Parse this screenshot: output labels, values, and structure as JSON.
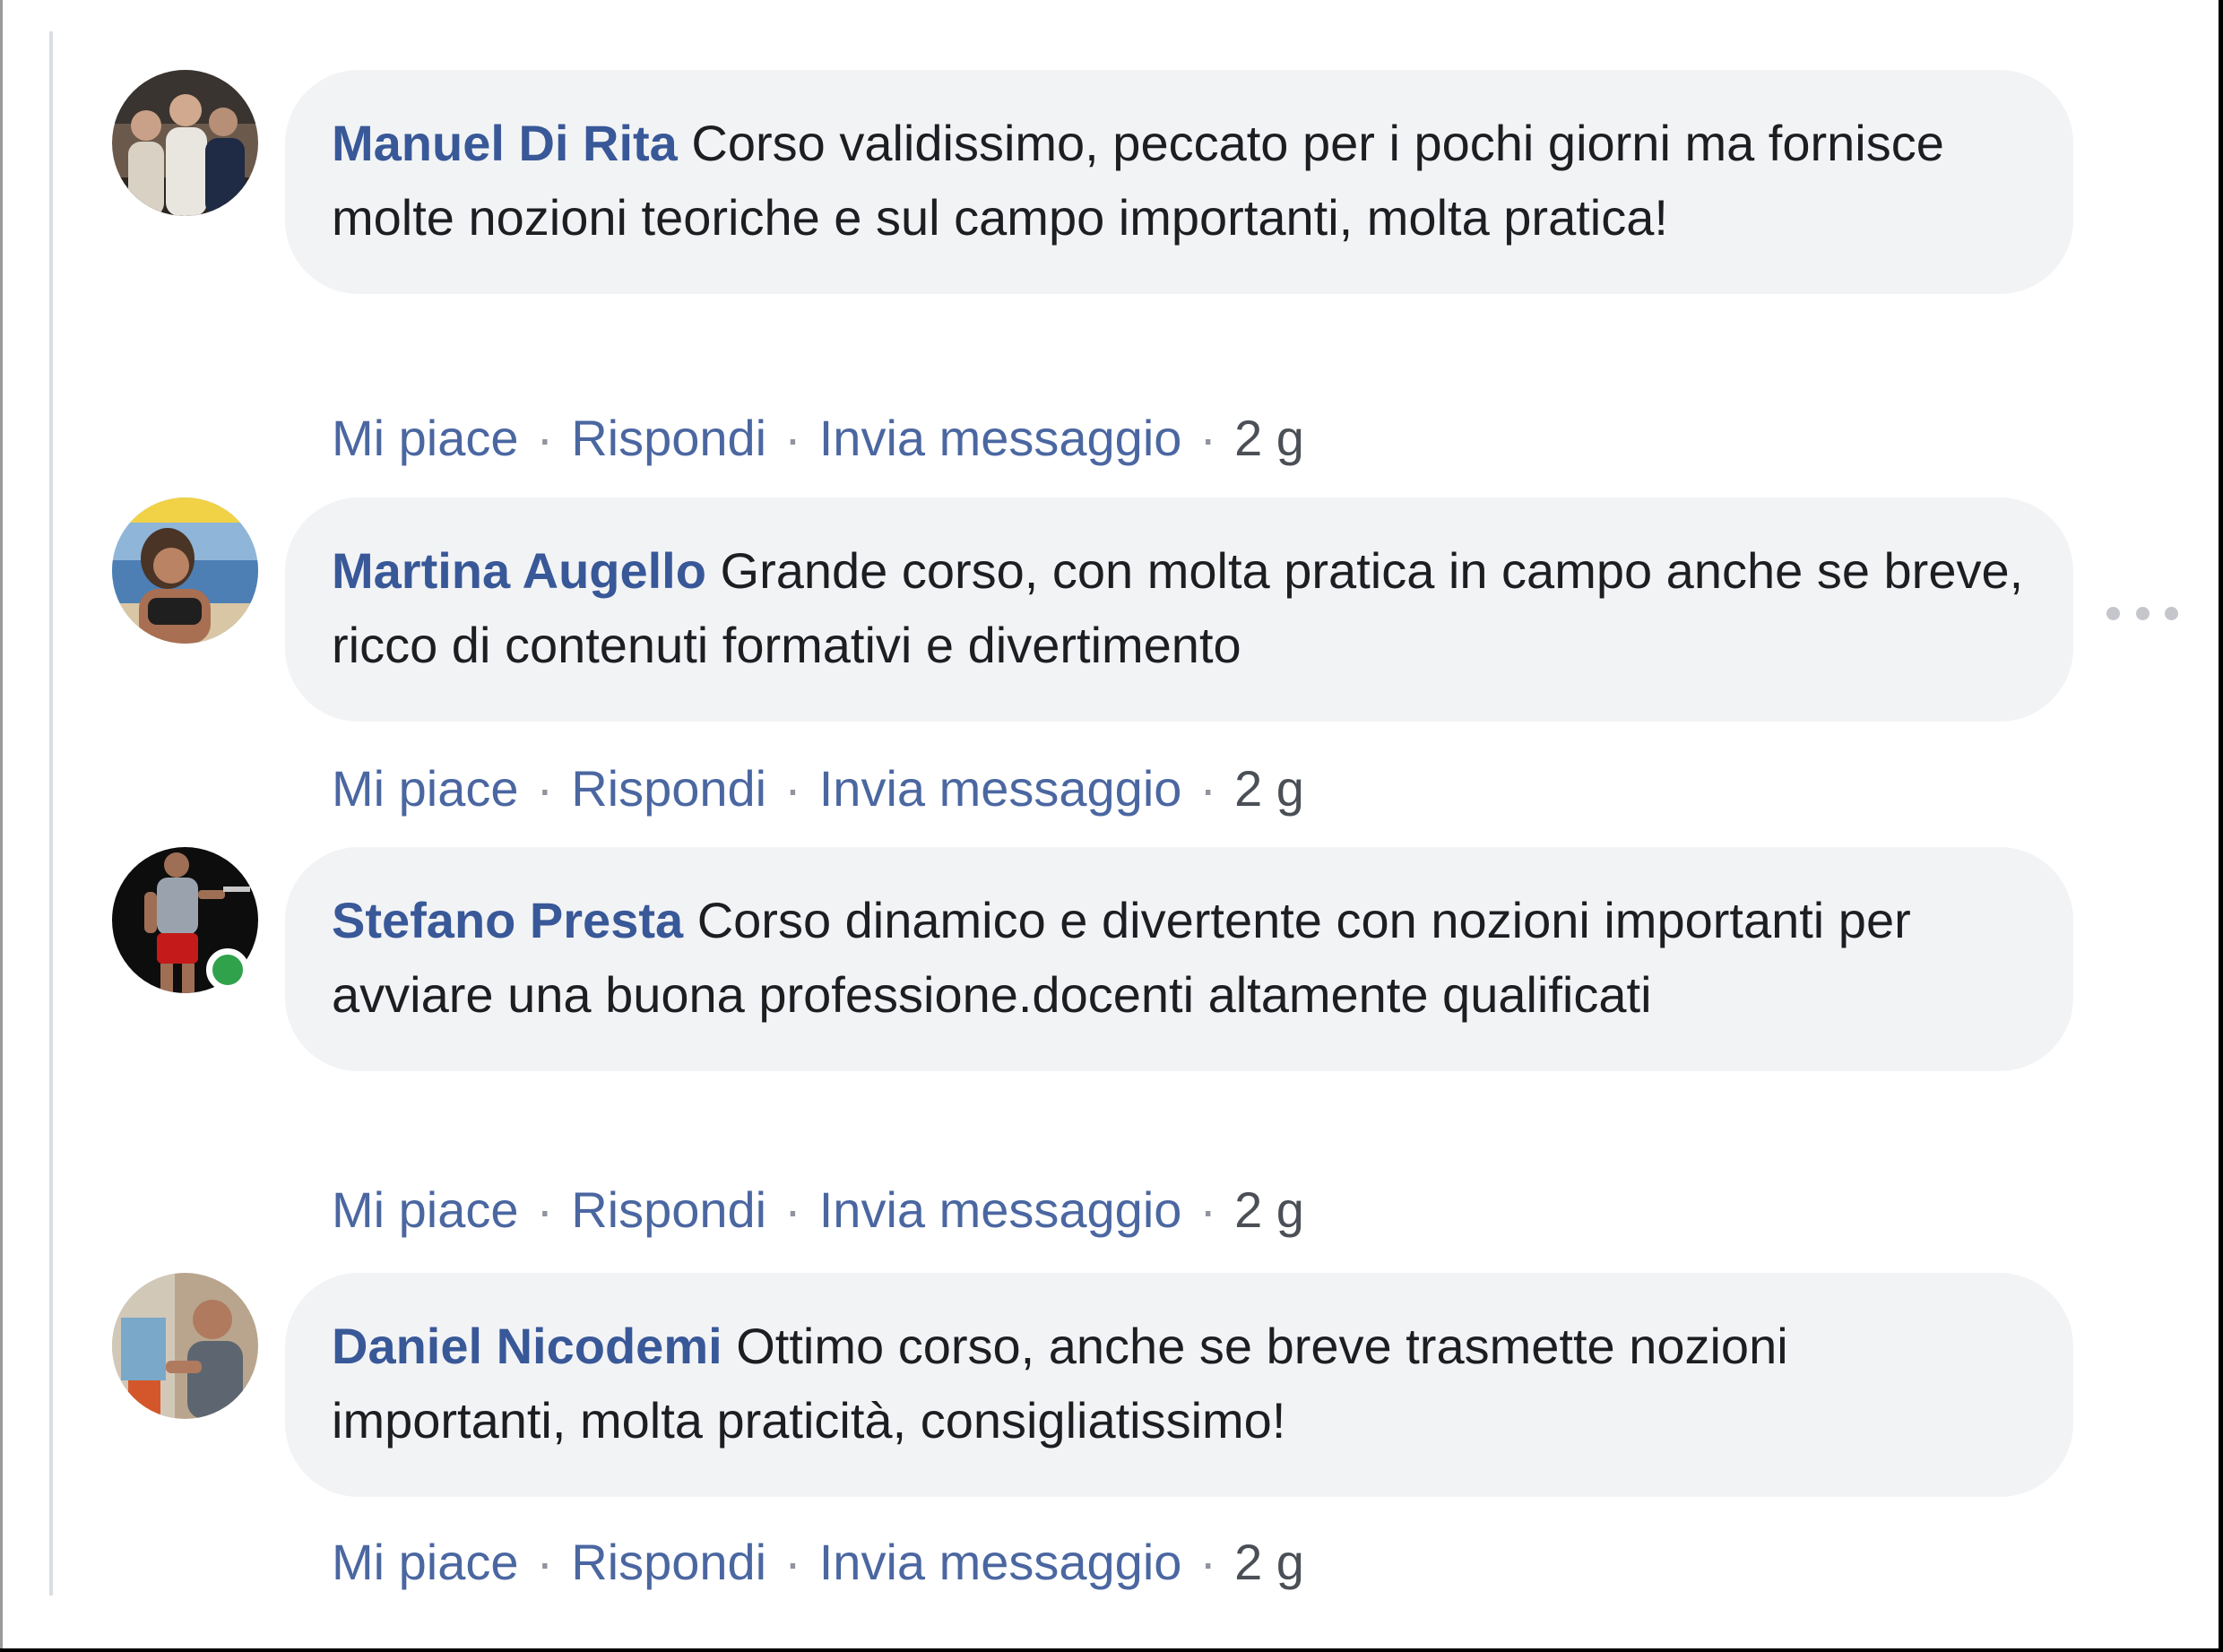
{
  "comments": [
    {
      "author": "Manuel Di Rita",
      "text": "Corso validissimo, peccato per i pochi giorni ma fornisce molte nozioni teoriche e sul campo importanti, molta pratica!",
      "online": false,
      "actions": {
        "like": "Mi piace",
        "reply": "Rispondi",
        "message": "Invia messaggio",
        "time": "2 g"
      }
    },
    {
      "author": "Martina Augello",
      "text": "Grande corso, con molta pratica in campo anche se breve, ricco di contenuti formativi e divertimento",
      "online": false,
      "actions": {
        "like": "Mi piace",
        "reply": "Rispondi",
        "message": "Invia messaggio",
        "time": "2 g"
      }
    },
    {
      "author": "Stefano Presta",
      "text": "Corso dinamico e divertente con nozioni importanti per avviare una buona professione.docenti altamente qualificati",
      "online": true,
      "actions": {
        "like": "Mi piace",
        "reply": "Rispondi",
        "message": "Invia messaggio",
        "time": "2 g"
      }
    },
    {
      "author": "Daniel Nicodemi",
      "text": "Ottimo corso, anche se breve trasmette nozioni importanti, molta praticità, consigliatissimo!",
      "online": false,
      "actions": {
        "like": "Mi piace",
        "reply": "Rispondi",
        "message": "Invia messaggio",
        "time": "2 g"
      }
    }
  ],
  "separator": "·",
  "icons": {
    "more": "more-options-icon",
    "online": "online-status-icon"
  },
  "colors": {
    "author": "#385898",
    "action_link": "#4b67a1",
    "bubble_background": "#f2f3f5",
    "online": "#31a24c"
  }
}
